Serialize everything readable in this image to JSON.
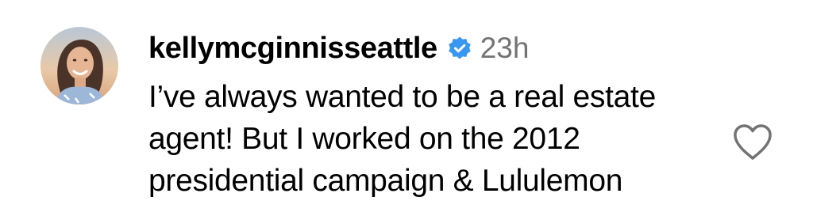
{
  "comment": {
    "username": "kellymcginnisseattle",
    "verified": true,
    "timestamp": "23h",
    "text_lines": [
      "I’ve always wanted to be a real estate",
      "agent! But I worked on the 2012",
      "presidential campaign & Lululemon"
    ],
    "avatar_icon": "profile-photo",
    "like_icon": "heart-outline-icon",
    "verified_icon": "verified-badge-icon"
  },
  "colors": {
    "verified_badge": "#3897f0",
    "timestamp": "#737373",
    "text": "#000000",
    "like_outline": "#737373"
  }
}
